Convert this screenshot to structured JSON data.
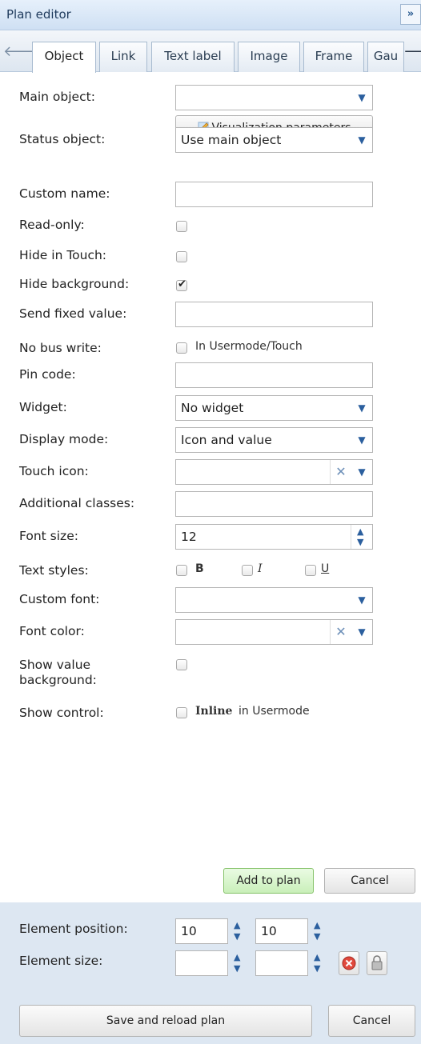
{
  "window": {
    "title": "Plan editor",
    "collapse_glyph": "»"
  },
  "tabs": [
    "Object",
    "Link",
    "Text label",
    "Image",
    "Frame",
    "Gau"
  ],
  "form": {
    "main_object_label": "Main object:",
    "main_object_value": "",
    "vis_params_label": "Visualization parameters",
    "status_object_label": "Status object:",
    "status_object_value": "Use main object",
    "custom_name_label": "Custom name:",
    "read_only_label": "Read-only:",
    "hide_touch_label": "Hide in Touch:",
    "hide_bg_label": "Hide background:",
    "send_fixed_label": "Send fixed value:",
    "no_bus_write_label": "No bus write:",
    "no_bus_write_option": "In Usermode/Touch",
    "pin_code_label": "Pin code:",
    "widget_label": "Widget:",
    "widget_value": "No widget",
    "display_mode_label": "Display mode:",
    "display_mode_value": "Icon and value",
    "touch_icon_label": "Touch icon:",
    "additional_classes_label": "Additional classes:",
    "font_size_label": "Font size:",
    "font_size_value": "12",
    "text_styles_label": "Text styles:",
    "style_bold": "B",
    "style_italic": "I",
    "style_underline": "U",
    "custom_font_label": "Custom font:",
    "font_color_label": "Font color:",
    "show_value_bg_label": "Show value background:",
    "show_control_label": "Show control:",
    "show_control_bold": "Inline",
    "show_control_rest": "in Usermode",
    "hide_bg_checked": true
  },
  "actions": {
    "add_label": "Add to plan",
    "cancel_label": "Cancel"
  },
  "bottom": {
    "position_label": "Element position:",
    "pos_x": "10",
    "pos_y": "10",
    "size_label": "Element size:",
    "save_label": "Save and reload plan",
    "cancel_label": "Cancel"
  },
  "icons": {
    "delete": "delete-icon",
    "lock": "lock-icon",
    "pencil": "pencil-icon"
  }
}
